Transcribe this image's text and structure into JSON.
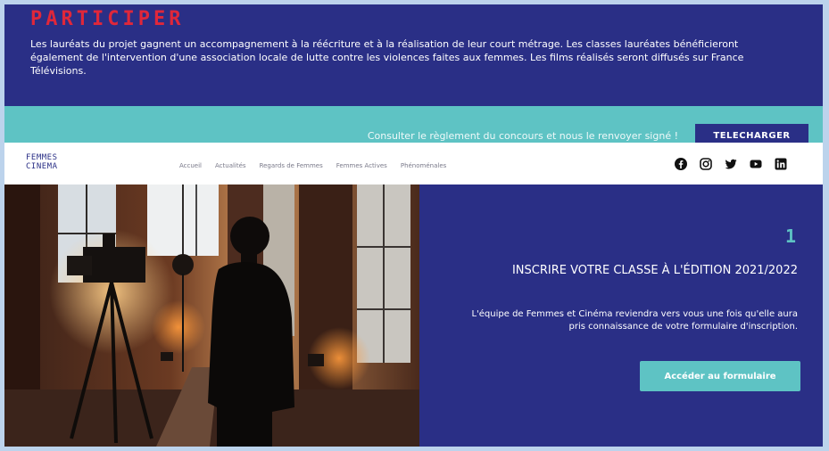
{
  "participer": {
    "heading": "PARTICIPER",
    "text": "Les lauréats du projet gagnent un accompagnement à la réécriture et à la réalisation de leur court métrage. Les classes lauréates bénéficieront également de l'intervention d'une association locale de lutte contre les violences faites aux femmes. Les films réalisés seront diffusés sur France Télévisions."
  },
  "reglement": {
    "message": "Consulter le règlement du concours et nous le renvoyer signé !",
    "button_label": "TELECHARGER"
  },
  "nav": {
    "logo_line1": "FEMMES",
    "logo_line2": "CINEMA",
    "items": [
      {
        "label": "Accueil"
      },
      {
        "label": "Actualités"
      },
      {
        "label": "Regards de Femmes"
      },
      {
        "label": "Femmes Actives"
      },
      {
        "label": "Phénoménales"
      }
    ],
    "socials": [
      "facebook-icon",
      "instagram-icon",
      "twitter-icon",
      "youtube-icon",
      "linkedin-icon"
    ]
  },
  "hero": {
    "step": "1",
    "title": "INSCRIRE VOTRE CLASSE À L'ÉDITION 2021/2022",
    "description": "L'équipe de Femmes et Cinéma reviendra vers vous une fois qu'elle aura pris connaissance de votre formulaire d'inscription.",
    "button_label": "Accéder au formulaire"
  },
  "colors": {
    "navy": "#2a2f86",
    "teal": "#5ec3c4",
    "red": "#e0273a",
    "white": "#ffffff"
  }
}
